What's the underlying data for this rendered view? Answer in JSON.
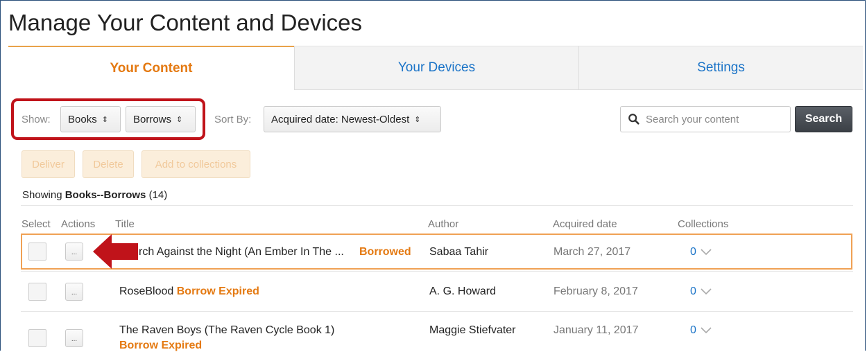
{
  "page_title": "Manage Your Content and Devices",
  "tabs": [
    {
      "label": "Your Content"
    },
    {
      "label": "Your Devices"
    },
    {
      "label": "Settings"
    }
  ],
  "filters": {
    "show_label": "Show:",
    "show_type": "Books",
    "show_subtype": "Borrows",
    "sort_label": "Sort By:",
    "sort_value": "Acquired date: Newest-Oldest",
    "search_placeholder": "Search your content",
    "search_button": "Search"
  },
  "actions": {
    "deliver": "Deliver",
    "delete": "Delete",
    "add_to_collections": "Add to collections"
  },
  "showing": {
    "prefix": "Showing ",
    "filter": "Books--Borrows",
    "count": " (14)"
  },
  "columns": {
    "select": "Select",
    "actions": "Actions",
    "title": "Title",
    "author": "Author",
    "acquired": "Acquired date",
    "collections": "Collections"
  },
  "rows": [
    {
      "title": "rch Against the Night (An Ember In The ...",
      "status": "Borrowed",
      "author": "Sabaa Tahir",
      "acquired": "March 27, 2017",
      "collections": "0",
      "action_label": "..."
    },
    {
      "title": "RoseBlood",
      "status": "Borrow Expired",
      "author": "A. G. Howard",
      "acquired": "February 8, 2017",
      "collections": "0",
      "action_label": "..."
    },
    {
      "title": "The Raven Boys (The Raven Cycle Book 1)",
      "status": "Borrow Expired",
      "author": "Maggie Stiefvater",
      "acquired": "January 11, 2017",
      "collections": "0",
      "action_label": "..."
    }
  ],
  "colors": {
    "accent_orange": "#e47911",
    "link_blue": "#1a73c7",
    "annotation_red": "#c0131a"
  }
}
